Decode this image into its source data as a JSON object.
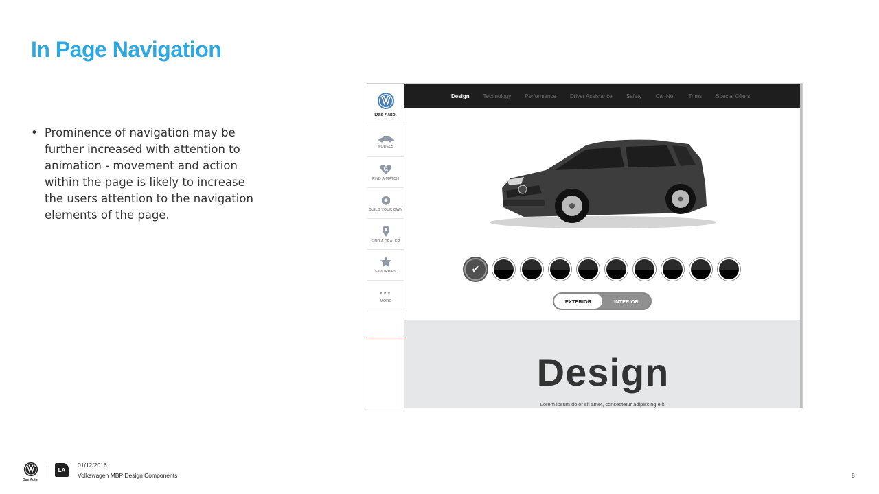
{
  "slide": {
    "title": "In Page Navigation",
    "bullet_symbol": "•",
    "bullets": [
      "Prominence of navigation may be further increased with attention to animation - movement and action within the page is likely to increase the users attention to the navigation elements of the page."
    ]
  },
  "mock": {
    "sidebar": {
      "logo_icon": "vw-logo-icon",
      "slogan": "Das Auto.",
      "items": [
        {
          "icon": "car-icon",
          "label": "MODELS"
        },
        {
          "icon": "heart-search-icon",
          "label": "FIND A MATCH"
        },
        {
          "icon": "hexagon-icon",
          "label": "BUILD YOUR OWN"
        },
        {
          "icon": "map-pin-icon",
          "label": "FIND A DEALER"
        },
        {
          "icon": "star-icon",
          "label": "FAVORITES"
        },
        {
          "icon": "dots-icon",
          "glyph": "•••",
          "label": "MORE"
        }
      ],
      "accent_color": "#e53935"
    },
    "nav": {
      "items": [
        "Design",
        "Technology",
        "Performance",
        "Driver Assistance",
        "Safety",
        "Car-Net",
        "Trims",
        "Special Offers"
      ],
      "active": "Design",
      "background": "#1e1e1e"
    },
    "car": {
      "icon": "car-image",
      "color": "#3d3d3d"
    },
    "swatches": {
      "count": 10,
      "selected_index": 0,
      "check_glyph": "✔"
    },
    "view_toggle": {
      "options": [
        "EXTERIOR",
        "INTERIOR"
      ],
      "selected": "EXTERIOR"
    },
    "section": {
      "heading": "Design",
      "body": "Lorem ipsum dolor sit amet, consectetur adipiscing elit."
    }
  },
  "footer": {
    "slogan": "Das Auto.",
    "badge": "LA",
    "date": "01/12/2016",
    "title": "Volkswagen MBP Design Components",
    "page": "8"
  },
  "colors": {
    "title_blue": "#2ea8e0",
    "vw_blue": "#4a7fb5"
  }
}
